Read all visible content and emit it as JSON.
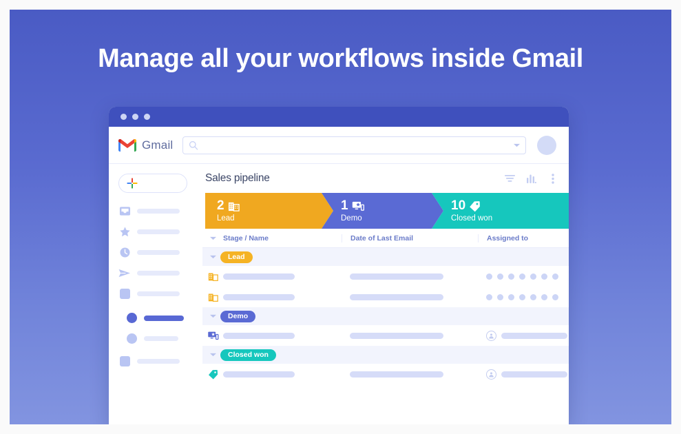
{
  "hero": {
    "title": "Manage all your workflows inside Gmail",
    "gradient_top": "#4a5bc4",
    "gradient_bottom": "#8294e0"
  },
  "window": {
    "chrome_color": "#3f50bd",
    "dot_color": "#cdd5f4"
  },
  "gmail": {
    "wordmark": "Gmail",
    "search_placeholder": "",
    "search_value": ""
  },
  "sidebar": {
    "compose_label": "",
    "items": [
      {
        "icon": "inbox-icon",
        "label": ""
      },
      {
        "icon": "star-icon",
        "label": ""
      },
      {
        "icon": "clock-icon",
        "label": ""
      },
      {
        "icon": "send-icon",
        "label": ""
      },
      {
        "icon": "drafts-icon",
        "label": ""
      },
      {
        "icon": "circle-icon",
        "label": "",
        "active": true
      },
      {
        "icon": "circle-icon",
        "label": ""
      },
      {
        "icon": "square-icon",
        "label": ""
      }
    ]
  },
  "board": {
    "title": "Sales pipeline",
    "tools": [
      {
        "name": "filter-icon"
      },
      {
        "name": "chart-icon"
      },
      {
        "name": "more-options-icon"
      }
    ]
  },
  "pipeline": {
    "stages": [
      {
        "count": "2",
        "label": "Lead",
        "color": "#f0a820",
        "icon": "building-icon"
      },
      {
        "count": "1",
        "label": "Demo",
        "color": "#5a6ad4",
        "icon": "monitor-icon"
      },
      {
        "count": "10",
        "label": "Closed won",
        "color": "#16c7bd",
        "icon": "tag-icon"
      }
    ]
  },
  "table": {
    "columns": [
      "Stage / Name",
      "Date of Last Email",
      "Assigned to"
    ],
    "groups": [
      {
        "badge": "Lead",
        "badge_color": "#f5b324",
        "rows": [
          {
            "icon": "building-icon",
            "name": "",
            "date": "",
            "assigned_dots": 7
          },
          {
            "icon": "building-icon",
            "name": "",
            "date": "",
            "assigned_dots": 7
          }
        ]
      },
      {
        "badge": "Demo",
        "badge_color": "#5a6ad4",
        "rows": [
          {
            "icon": "monitor-icon",
            "name": "",
            "date": "",
            "assigned_avatar": true
          }
        ]
      },
      {
        "badge": "Closed won",
        "badge_color": "#16c7bd",
        "rows": [
          {
            "icon": "tag-icon",
            "name": "",
            "date": "",
            "assigned_avatar": true
          }
        ]
      }
    ]
  }
}
